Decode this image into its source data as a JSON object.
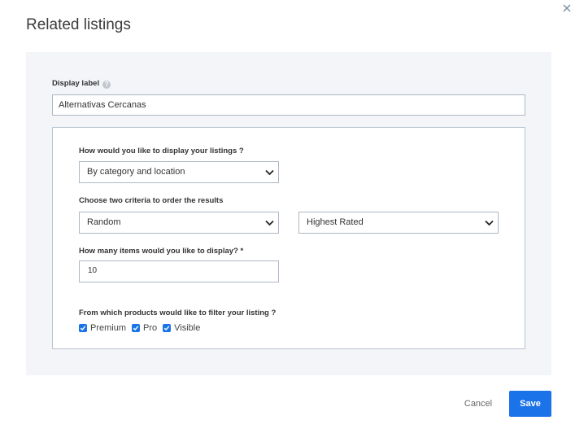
{
  "dialog": {
    "title": "Related listings",
    "close_icon": "close-icon",
    "cancel_label": "Cancel",
    "save_label": "Save"
  },
  "display_label": {
    "label": "Display label",
    "help_icon": "?",
    "value": "Alternativas Cercanas"
  },
  "settings": {
    "display_question": "How would you like to display your listings ?",
    "display_selected": "By category and location",
    "order_question": "Choose two criteria to order the results",
    "order_first_selected": "Random",
    "order_second_selected": "Highest Rated",
    "items_question": "How many items would you like to display? *",
    "items_value": "10",
    "filter_question": "From which products would like to filter your listing ?",
    "filters": [
      {
        "label": "Premium",
        "checked": true
      },
      {
        "label": "Pro",
        "checked": true
      },
      {
        "label": "Visible",
        "checked": true
      }
    ]
  },
  "colors": {
    "accent": "#1a73e8",
    "panel_bg": "#f3f5f9",
    "border": "#aeb8c4"
  }
}
